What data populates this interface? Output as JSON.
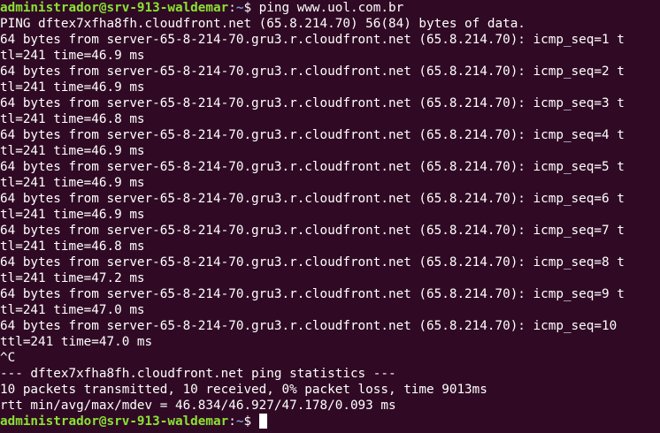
{
  "colors": {
    "background": "#300a24",
    "text": "#ffffff",
    "prompt_user_host": "#8ae234",
    "prompt_path": "#729fcf",
    "cursor": "#ffffff"
  },
  "prompt": {
    "user_host": "administrador@srv-913-waldemar",
    "separator": ":",
    "path": "~",
    "symbol": "$ "
  },
  "command": "ping www.uol.com.br",
  "output": [
    "PING dftex7xfha8fh.cloudfront.net (65.8.214.70) 56(84) bytes of data.",
    "64 bytes from server-65-8-214-70.gru3.r.cloudfront.net (65.8.214.70): icmp_seq=1 t",
    "tl=241 time=46.9 ms",
    "64 bytes from server-65-8-214-70.gru3.r.cloudfront.net (65.8.214.70): icmp_seq=2 t",
    "tl=241 time=46.9 ms",
    "64 bytes from server-65-8-214-70.gru3.r.cloudfront.net (65.8.214.70): icmp_seq=3 t",
    "tl=241 time=46.8 ms",
    "64 bytes from server-65-8-214-70.gru3.r.cloudfront.net (65.8.214.70): icmp_seq=4 t",
    "tl=241 time=46.9 ms",
    "64 bytes from server-65-8-214-70.gru3.r.cloudfront.net (65.8.214.70): icmp_seq=5 t",
    "tl=241 time=46.9 ms",
    "64 bytes from server-65-8-214-70.gru3.r.cloudfront.net (65.8.214.70): icmp_seq=6 t",
    "tl=241 time=46.9 ms",
    "64 bytes from server-65-8-214-70.gru3.r.cloudfront.net (65.8.214.70): icmp_seq=7 t",
    "tl=241 time=46.8 ms",
    "64 bytes from server-65-8-214-70.gru3.r.cloudfront.net (65.8.214.70): icmp_seq=8 t",
    "tl=241 time=47.2 ms",
    "64 bytes from server-65-8-214-70.gru3.r.cloudfront.net (65.8.214.70): icmp_seq=9 t",
    "tl=241 time=47.0 ms",
    "64 bytes from server-65-8-214-70.gru3.r.cloudfront.net (65.8.214.70): icmp_seq=10",
    "ttl=241 time=47.0 ms",
    "^C",
    "--- dftex7xfha8fh.cloudfront.net ping statistics ---",
    "10 packets transmitted, 10 received, 0% packet loss, time 9013ms",
    "rtt min/avg/max/mdev = 46.834/46.927/47.178/0.093 ms"
  ]
}
